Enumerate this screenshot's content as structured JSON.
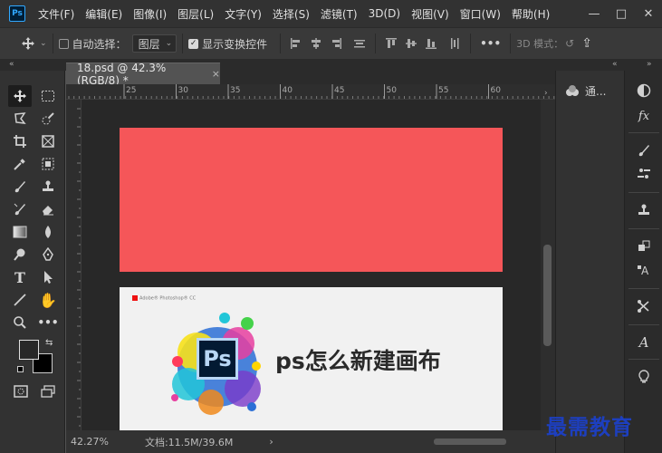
{
  "app": {
    "logo": "Ps"
  },
  "menu": [
    "文件(F)",
    "编辑(E)",
    "图像(I)",
    "图层(L)",
    "文字(Y)",
    "选择(S)",
    "滤镜(T)",
    "3D(D)",
    "视图(V)",
    "窗口(W)",
    "帮助(H)"
  ],
  "window_controls": {
    "minimize": "—",
    "maximize": "□",
    "close": "✕"
  },
  "options": {
    "auto_select_label": "自动选择：",
    "auto_select_checked": false,
    "layer_dropdown": "图层",
    "show_transform_label": "显示变换控件",
    "show_transform_checked": true,
    "three_d_mode_label": "3D 模式：",
    "more_label": "•••"
  },
  "document": {
    "tab_title": "18.psd @ 42.3%(RGB/8) *",
    "close": "×"
  },
  "rulers": {
    "h_labels": [
      "25",
      "30",
      "35",
      "40",
      "45",
      "50",
      "55",
      "60"
    ]
  },
  "canvas": {
    "red_color": "#f55659",
    "adobe_tag": "Adobe® Photoshop® CC",
    "ps_icon_text": "Ps",
    "headline": "ps怎么新建画布"
  },
  "status": {
    "zoom": "42.27%",
    "doc_info": "文档:11.5M/39.6M",
    "arrow": "›"
  },
  "panels": {
    "channels_label": "通..."
  },
  "watermark": "最需教育"
}
